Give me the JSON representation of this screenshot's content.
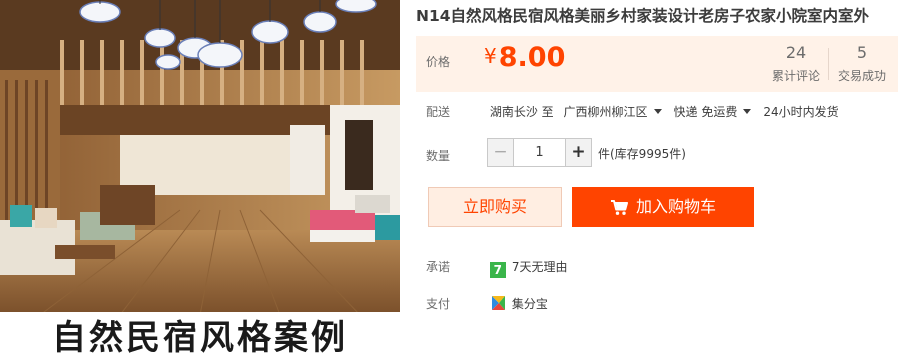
{
  "product_image": {
    "caption": "自然民宿风格案例"
  },
  "title": "N14自然风格民宿风格美丽乡村家装设计老房子农家小院室内室外",
  "price": {
    "label": "价格",
    "currency": "¥",
    "value": "8.00"
  },
  "stats": [
    {
      "number": "24",
      "label": "累计评论"
    },
    {
      "number": "5",
      "label": "交易成功"
    }
  ],
  "delivery": {
    "label": "配送",
    "from": "湖南长沙 至",
    "to": "广西柳州柳江区",
    "shipping": "快递 免运费",
    "time": "24小时内发货"
  },
  "quantity": {
    "label": "数量",
    "value": "1",
    "minus": "−",
    "plus": "+",
    "stock": "件(库存9995件)"
  },
  "buttons": {
    "buy_now": "立即购买",
    "add_to_cart": "加入购物车"
  },
  "promise": {
    "label": "承诺",
    "badge": "7",
    "text": "7天无理由"
  },
  "payment": {
    "label": "支付",
    "text": "集分宝"
  },
  "colors": {
    "accent": "#ff4400",
    "price_bg": "#fff2e8",
    "promise_green": "#3ab54a"
  }
}
